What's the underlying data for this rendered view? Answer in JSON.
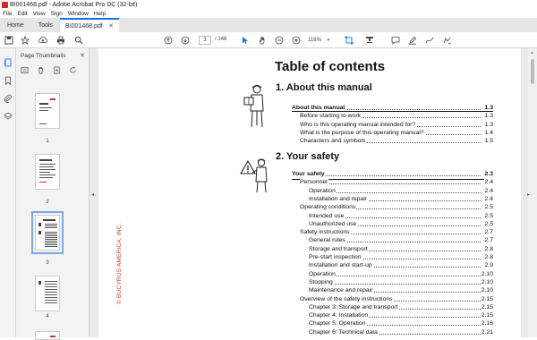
{
  "window": {
    "title": "BI001468.pdf - Adobe Acrobat Pro DC (32-bit)"
  },
  "menu": [
    "File",
    "Edit",
    "View",
    "Sign",
    "Window",
    "Help"
  ],
  "tabs": {
    "home": "Home",
    "tools": "Tools",
    "doc": "BI001468.pdf"
  },
  "toolbar": {
    "page_current": "3",
    "page_total": "/ 146",
    "zoom": "116%"
  },
  "thumbnails": {
    "header": "Page Thumbnails",
    "pages": [
      {
        "label": "1"
      },
      {
        "label": "2"
      },
      {
        "label": "3"
      },
      {
        "label": "4"
      }
    ]
  },
  "document": {
    "side_text": "© BUCYRUS AMERICA, INC.",
    "toc_title": "Table of contents",
    "sections": [
      {
        "heading": "1.  About this manual",
        "entries": [
          {
            "text": "About this manual",
            "page": "1.3",
            "level": 0,
            "bold": true
          },
          {
            "text": "Before starting to work",
            "page": "1.3",
            "level": 1
          },
          {
            "text": "Who is this operating manual intended for?",
            "page": "1.3",
            "level": 1
          },
          {
            "text": "What is the purpose of this operating manual?",
            "page": "1.4",
            "level": 1
          },
          {
            "text": "Characters and symbols",
            "page": "1.5",
            "level": 1
          }
        ]
      },
      {
        "heading": "2.  Your safety",
        "entries": [
          {
            "text": "Your safety",
            "page": "2.3",
            "level": 0,
            "bold": true
          },
          {
            "text": "Personnel",
            "page": "2.4",
            "level": 1
          },
          {
            "text": "Operation",
            "page": "2.4",
            "level": 2
          },
          {
            "text": "Installation and repair",
            "page": "2.4",
            "level": 2
          },
          {
            "text": "Operating conditions",
            "page": "2.5",
            "level": 1
          },
          {
            "text": "Intended use",
            "page": "2.5",
            "level": 2
          },
          {
            "text": "Unauthorized use",
            "page": "2.5",
            "level": 2
          },
          {
            "text": "Safety instructions",
            "page": "2.7",
            "level": 1
          },
          {
            "text": "General rules",
            "page": "2.7",
            "level": 2
          },
          {
            "text": "Storage and transport",
            "page": "2.8",
            "level": 2
          },
          {
            "text": "Pre-start inspection",
            "page": "2.8",
            "level": 2
          },
          {
            "text": "Installation and start-up",
            "page": "2.9",
            "level": 2
          },
          {
            "text": "Operation",
            "page": "2.10",
            "level": 2
          },
          {
            "text": "Stopping",
            "page": "2.10",
            "level": 2
          },
          {
            "text": "Maintenance and repair",
            "page": "2.10",
            "level": 2
          },
          {
            "text": "Overview of the safety instructions",
            "page": "2.15",
            "level": 1
          },
          {
            "text": "Chapter 3: Storage and transport",
            "page": "2.15",
            "level": 2
          },
          {
            "text": "Chapter 4: Installation",
            "page": "2.15",
            "level": 2
          },
          {
            "text": "Chapter 5: Operation",
            "page": "2.16",
            "level": 2
          },
          {
            "text": "Chapter 6: Technical data",
            "page": "2.21",
            "level": 2
          }
        ]
      }
    ]
  }
}
